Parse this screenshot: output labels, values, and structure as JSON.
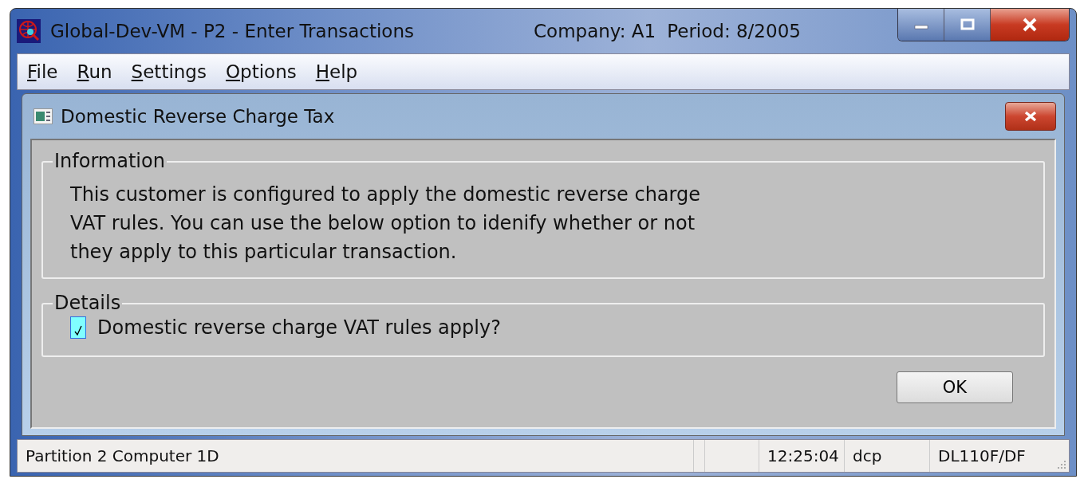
{
  "window": {
    "title": "Global-Dev-VM - P2 - Enter Transactions",
    "company": "Company: A1",
    "period": "Period:  8/2005"
  },
  "menu": [
    {
      "label": "File",
      "mnemonic_underlined": true
    },
    {
      "label": "Run",
      "mnemonic_underlined": true
    },
    {
      "label": "Settings",
      "mnemonic_underlined": true
    },
    {
      "label": "Options",
      "mnemonic_underlined": true
    },
    {
      "label": "Help",
      "mnemonic_underlined": true
    }
  ],
  "dialog": {
    "title": "Domestic Reverse Charge Tax",
    "information": {
      "legend": "Information",
      "text": "This customer is configured to apply the domestic reverse charge VAT rules. You can use the below option to idenify whether or not they apply to this particular transaction."
    },
    "details": {
      "legend": "Details",
      "checkbox": {
        "label": "Domestic reverse charge VAT rules apply?",
        "checked": true
      }
    },
    "buttons": [
      "OK"
    ]
  },
  "status_bar": [
    "Partition 2 Computer 1D",
    "12:25:04",
    "dcp",
    "DL110F/DF"
  ]
}
